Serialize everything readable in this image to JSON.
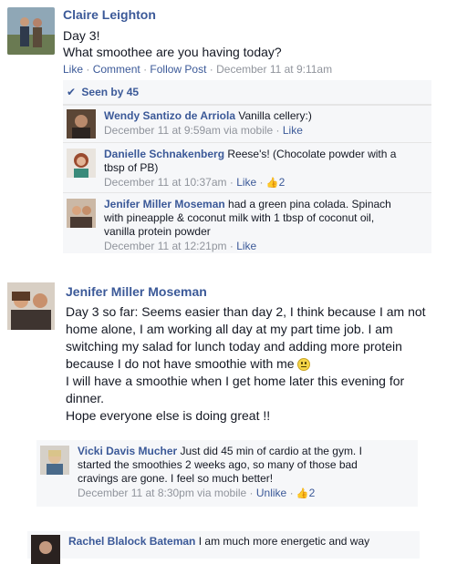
{
  "post1": {
    "author": "Claire Leighton",
    "line1": "Day 3!",
    "line2": "What smoothee are you having today?",
    "actions": {
      "like": "Like",
      "comment": "Comment",
      "follow": "Follow Post",
      "time": "December 11 at 9:11am"
    },
    "seen": "Seen by 45",
    "comments": [
      {
        "author": "Wendy Santizo de Arriola",
        "text": " Vanilla cellery:)",
        "text2": "",
        "time": "December 11 at 9:59am via mobile",
        "like": "Like",
        "likes": ""
      },
      {
        "author": "Danielle Schnakenberg",
        "text": " Reese's! (Chocolate powder with a",
        "text2": "tbsp of PB)",
        "time": "December 11 at 10:37am",
        "like": "Like",
        "likes": "2"
      },
      {
        "author": "Jenifer Miller Moseman",
        "text": " had a green pina colada. Spinach",
        "text2": "with pineapple & coconut milk with 1 tbsp of coconut oil,",
        "text3": "vanilla protein powder",
        "time": "December 11 at 12:21pm",
        "like": "Like",
        "likes": ""
      }
    ]
  },
  "post2": {
    "author": "Jenifer Miller Moseman",
    "lines": [
      "Day 3 so far: Seems easier than day 2, I think because I am not",
      "home alone, I am working all day at my part time job. I am",
      "switching my salad for lunch today and adding more protein",
      "because I do not have smoothie with me",
      "I will have a smoothie when I get home later this evening for",
      "dinner.",
      "Hope everyone else is doing great !!"
    ],
    "comments": [
      {
        "author": "Vicki Davis Mucher",
        "text": " Just did 45 min of cardio at the gym. I",
        "text2": "started the smoothies 2 weeks ago, so many of those bad",
        "text3": "cravings are gone. I feel so much better!",
        "time": "December 11 at 8:30pm via mobile",
        "like": "Unlike",
        "likes": "2"
      },
      {
        "author": "Rachel Blalock Bateman",
        "text": " I am much more energetic and way"
      }
    ]
  },
  "icons": {
    "check": "checkmark-icon",
    "thumb": "thumbs-up-icon",
    "smiley": "sad-smiley-icon"
  },
  "colors": {
    "link": "#3b5998",
    "meta": "#90949c",
    "comment_bg": "#f6f7f9"
  }
}
